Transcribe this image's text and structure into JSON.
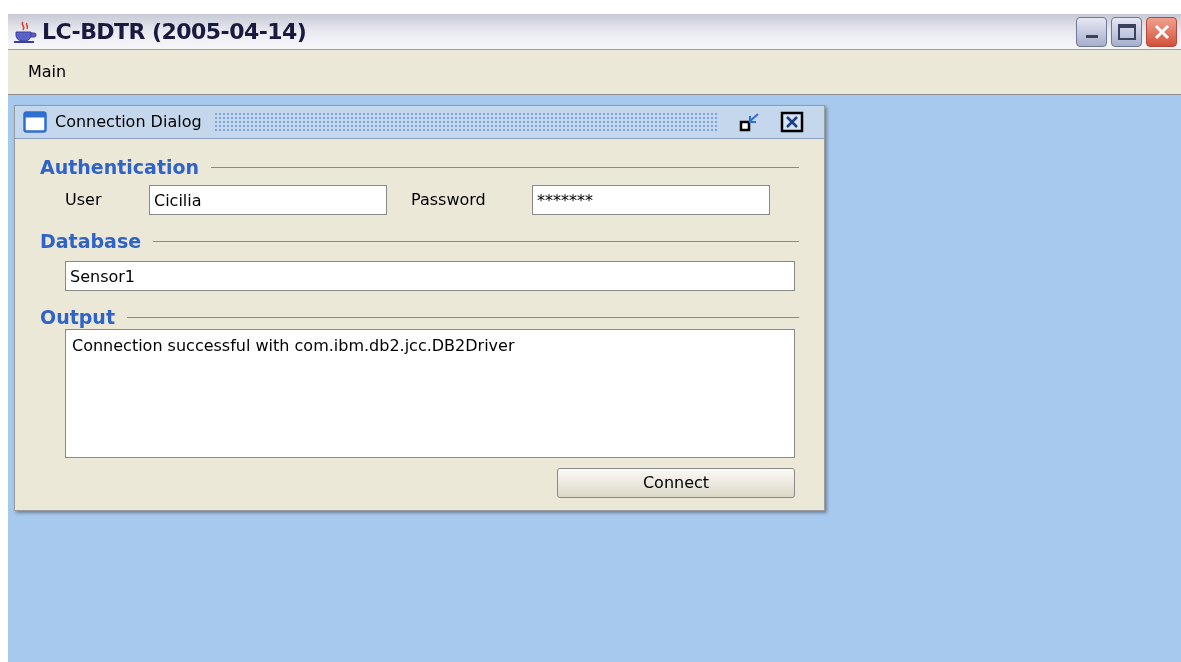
{
  "window": {
    "title": "LC-BDTR (2005-04-14)"
  },
  "menu": [
    {
      "label": "Main"
    }
  ],
  "dialog": {
    "title": "Connection Dialog",
    "authentication": {
      "heading": "Authentication",
      "user_label": "User",
      "user_value": "Cicilia",
      "password_label": "Password",
      "password_value": "*******"
    },
    "database": {
      "heading": "Database",
      "value": "Sensor1"
    },
    "output": {
      "heading": "Output",
      "text": "Connection successful with com.ibm.db2.jcc.DB2Driver"
    },
    "button": "Connect"
  }
}
